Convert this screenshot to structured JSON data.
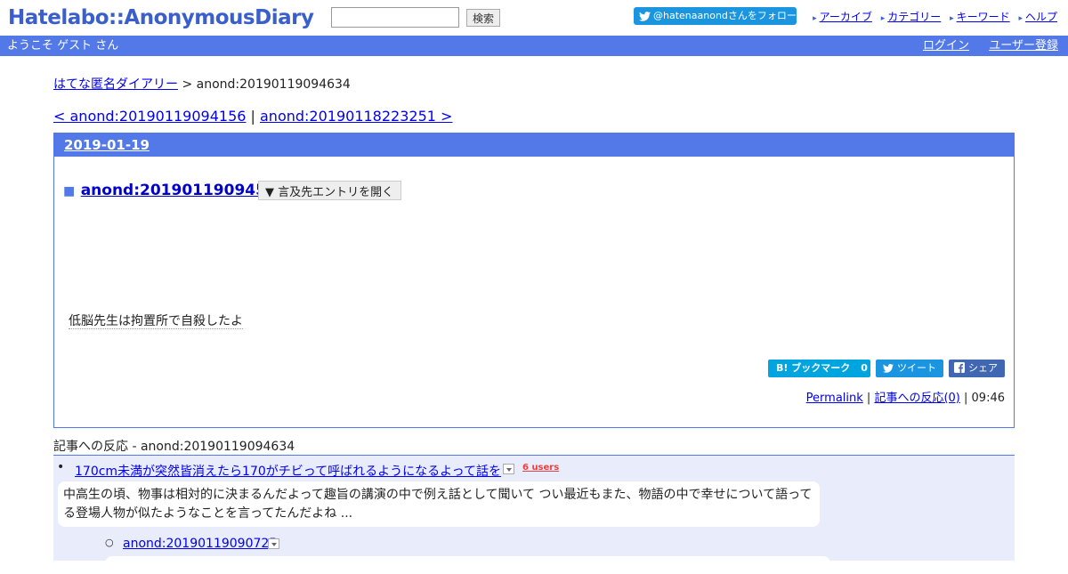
{
  "header": {
    "logo": "Hatelabo::AnonymousDiary",
    "search_button": "検索",
    "search_value": "",
    "twitter_follow": "@hatenaanondさんをフォロー",
    "nav": [
      "アーカイブ",
      "カテゴリー",
      "キーワード",
      "ヘルプ"
    ]
  },
  "welcome_bar": {
    "greeting": "ようこそ ゲスト さん",
    "login": "ログイン",
    "register": "ユーザー登録"
  },
  "breadcrumb": {
    "home": "はてな匿名ダイアリー",
    "separator": " > ",
    "current": "anond:20190119094634"
  },
  "pager": {
    "prev": "< anond:20190119094156",
    "separator": " | ",
    "next": "anond:20190118223251 >"
  },
  "article": {
    "date": "2019-01-19",
    "square": "■",
    "title": "anond:20190119094554",
    "reference_toggle": "▼ 言及先エントリを開く",
    "body": "低脳先生は拘置所で自殺したよ",
    "bookmark_label": "B! ブックマーク",
    "bookmark_count": "0",
    "tweet_label": "ツイート",
    "share_label": "シェア",
    "permalink": "Permalink",
    "footer_sep": " | ",
    "reactions_link": "記事への反応(0)",
    "time": "09:46"
  },
  "reactions": {
    "header": "記事への反応 - anond:20190119094634",
    "items": [
      {
        "title": "170cm未満が突然皆消えたら170がチビって呼ばれるようになるよって話を",
        "users": "6 users",
        "excerpt": "中高生の頃、物事は相対的に決まるんだよって趣旨の講演の中で例え話として聞いて つい最近もまた、物語の中で幸せについて語ってる登場人物が似たようなことを言ってたんだよね ..."
      },
      {
        "title": "anond:20190119090725"
      }
    ]
  }
}
